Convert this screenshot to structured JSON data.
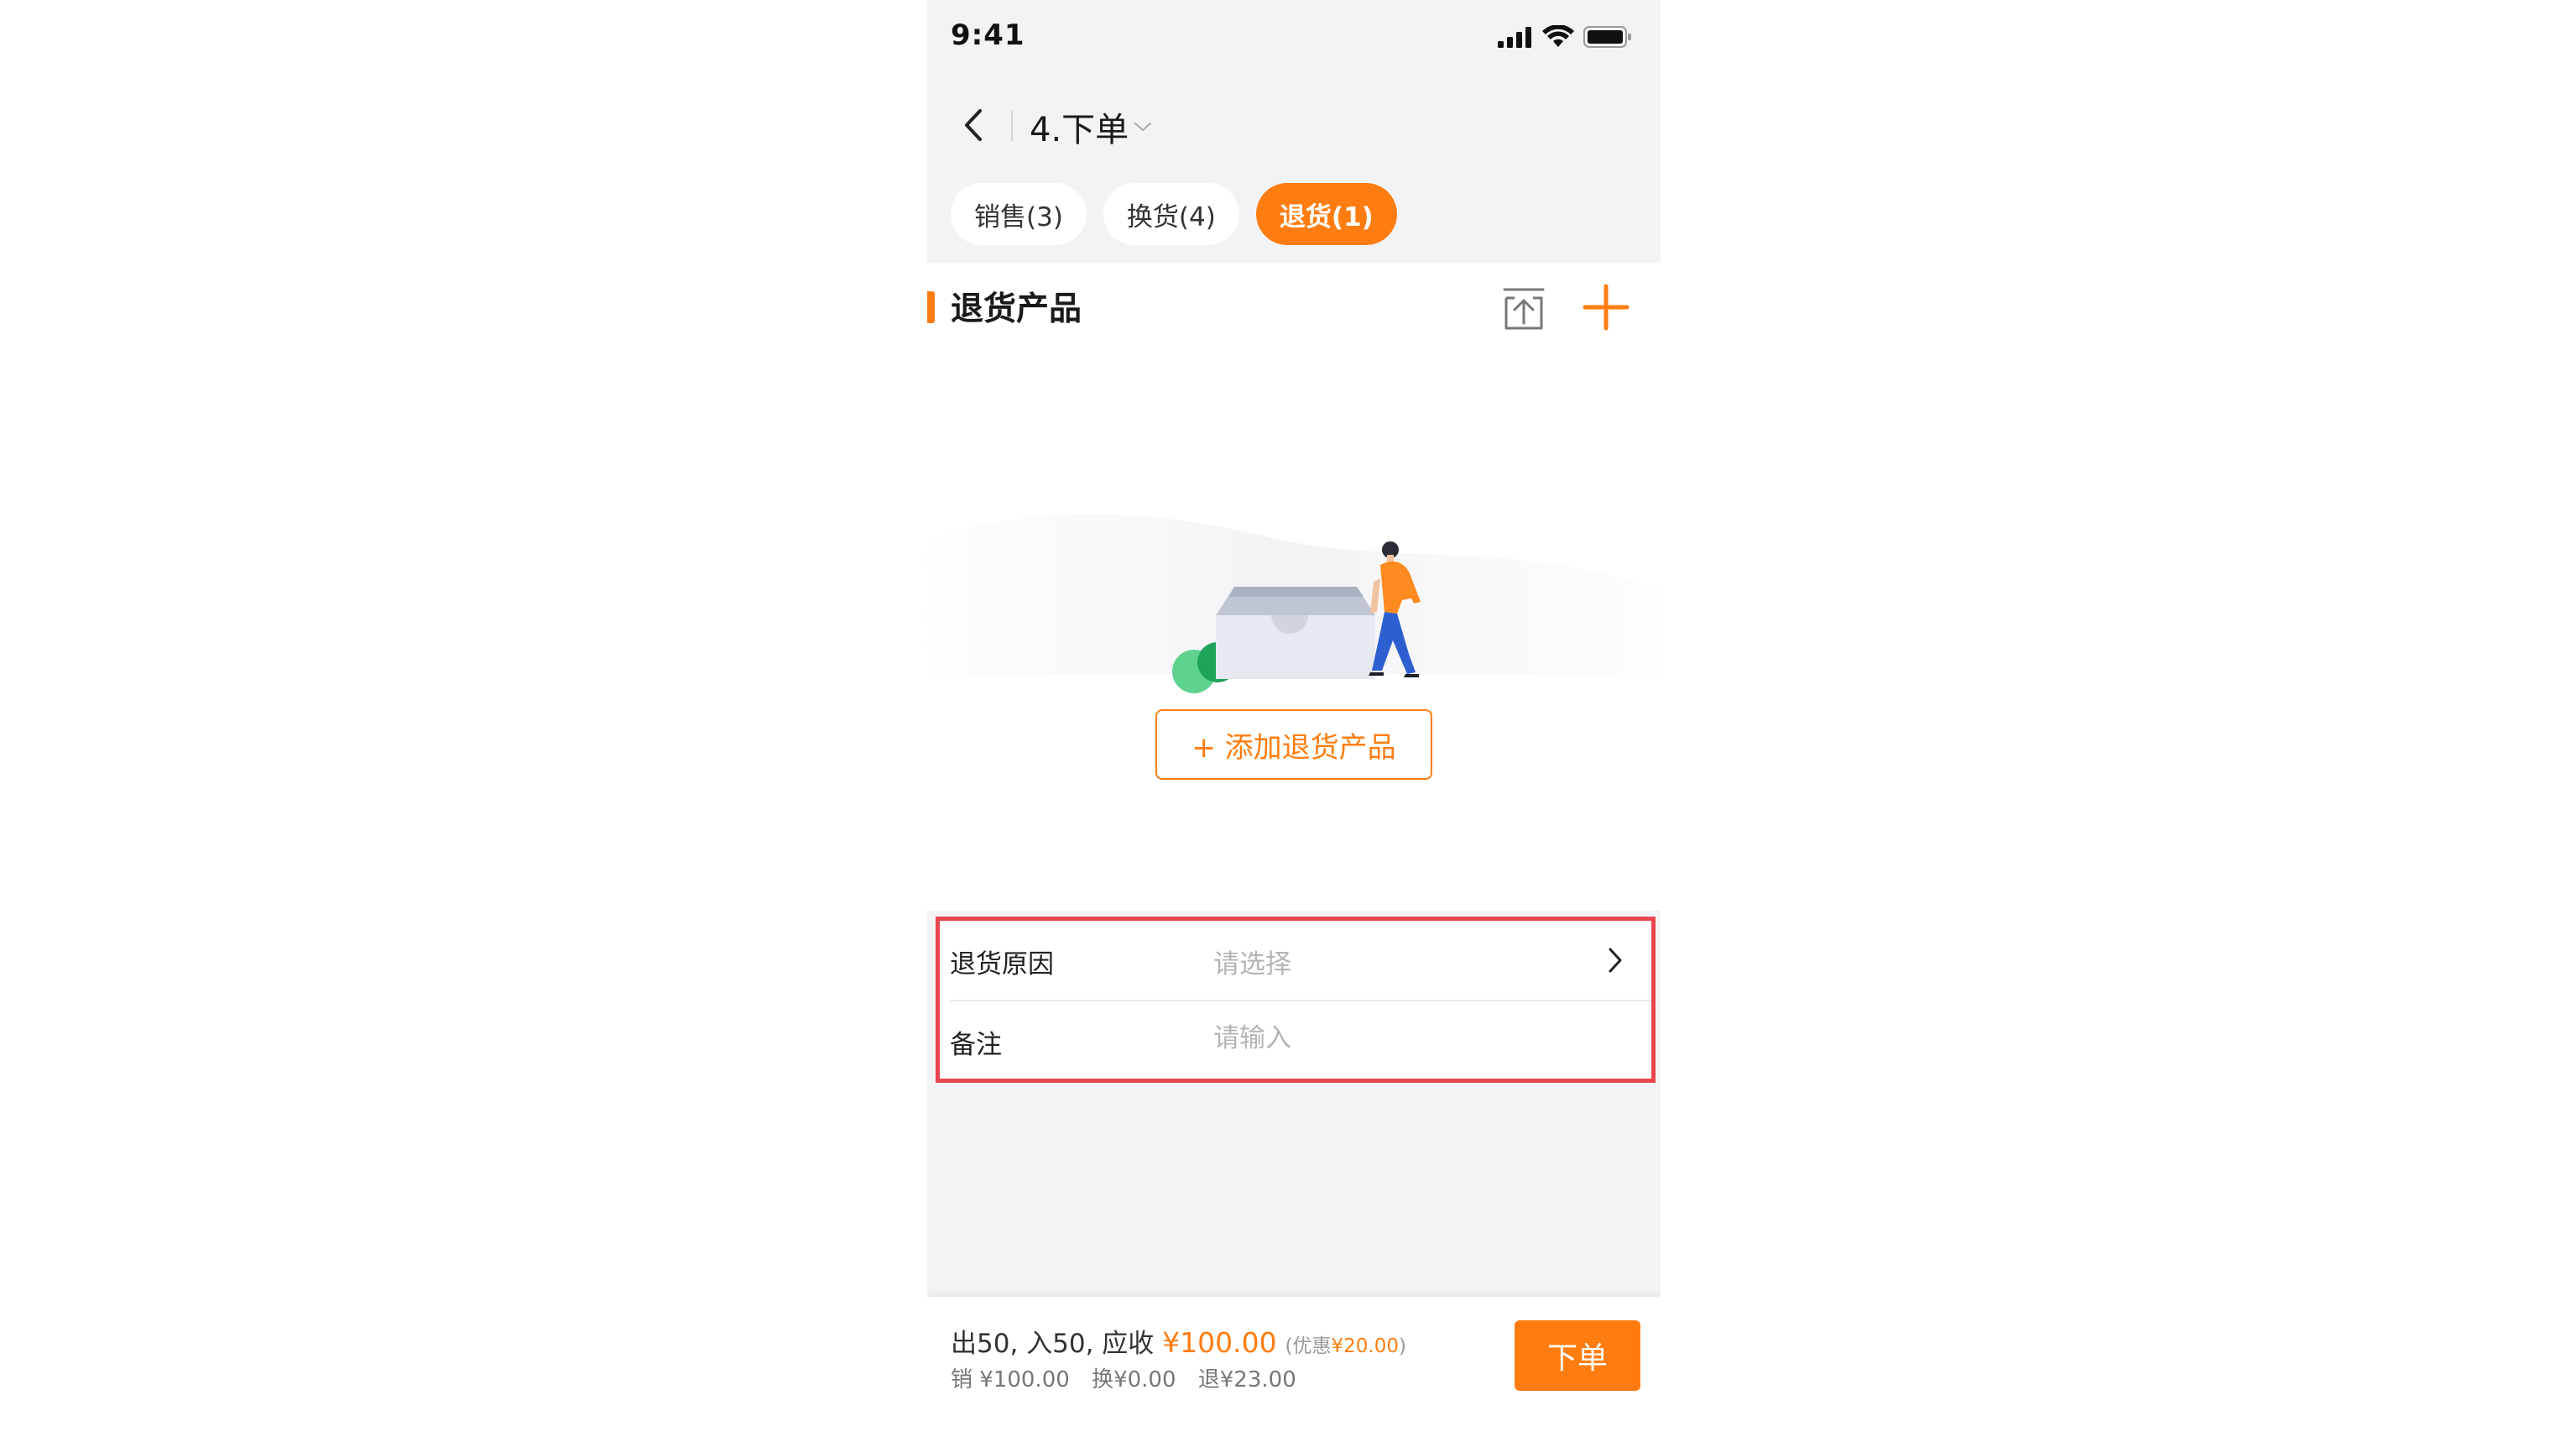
{
  "status_bar": {
    "time": "9:41"
  },
  "nav": {
    "title": "4.下单"
  },
  "tabs": [
    {
      "label": "销售(3)",
      "active": false
    },
    {
      "label": "换货(4)",
      "active": false
    },
    {
      "label": "退货(1)",
      "active": true
    }
  ],
  "section": {
    "title": "退货产品"
  },
  "empty_state": {
    "add_button_label": "+ 添加退货产品"
  },
  "form": {
    "reason_label": "退货原因",
    "reason_placeholder": "请选择",
    "remark_label": "备注",
    "remark_placeholder": "请输入"
  },
  "summary": {
    "counts_text": "出50, 入50, 应收",
    "total": "¥100.00",
    "discount_prefix": "(优惠",
    "discount_amount": "¥20.00",
    "discount_suffix": ")",
    "sale": "销 ¥100.00",
    "exchange": "换¥0.00",
    "return": "退¥23.00"
  },
  "order_button": {
    "label": "下单"
  },
  "colors": {
    "accent": "#ff7d10",
    "highlight_border": "#e8464f",
    "background_grey": "#f3f3f5"
  },
  "icons": {
    "back": "chevron-left-icon",
    "title_dropdown": "chevron-down-icon",
    "upload": "upload-icon",
    "add": "plus-icon",
    "chevron": "chevron-right-icon"
  }
}
